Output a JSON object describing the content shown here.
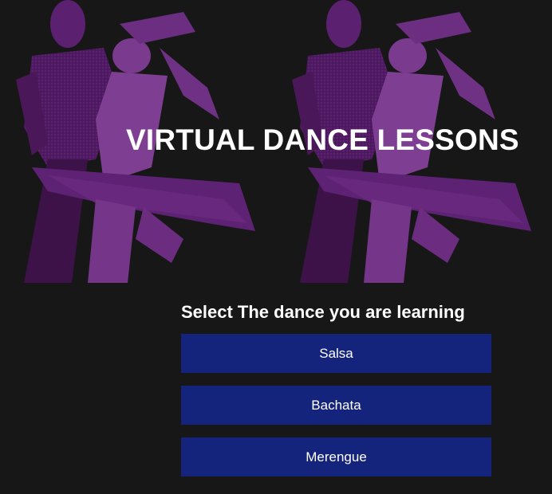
{
  "hero": {
    "title": "VIRTUAL DANCE LESSONS",
    "image_description": "dancing-couple-photo",
    "tint_color": "#5a1e6e"
  },
  "selector": {
    "heading": "Select The dance you are learning",
    "options": [
      {
        "label": "Salsa"
      },
      {
        "label": "Bachata"
      },
      {
        "label": "Merengue"
      }
    ],
    "button_color": "#14247c"
  },
  "colors": {
    "background": "#171717",
    "text": "#ffffff"
  }
}
